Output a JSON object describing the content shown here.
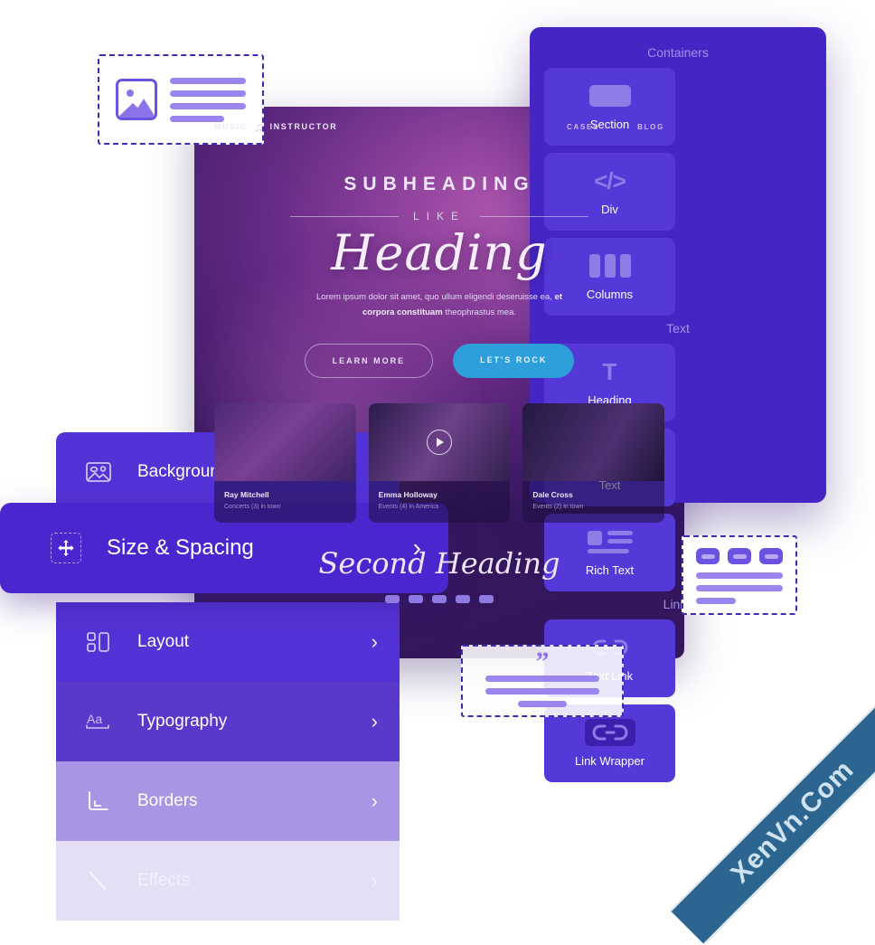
{
  "wireframes": {
    "image_block": {
      "name": "image-placeholder",
      "line_count": 4
    },
    "button_block": {
      "name": "button-placeholder",
      "button_count": 3,
      "line_count": 3
    },
    "quote_block": {
      "name": "quote-placeholder",
      "quote_glyph": "”",
      "line_count": 3
    }
  },
  "site": {
    "logo": {
      "word1": "MUSIC",
      "note_icon": "♫",
      "word2": "INSTRUCTOR"
    },
    "nav": [
      "CASES",
      "BLOG"
    ],
    "hero": {
      "subheading": "SUBHEADING",
      "like": "LIKE",
      "heading": "Heading",
      "copy_line1": "Lorem ipsum dolor sit amet, quo ullum eligendi",
      "copy_line2_plain": "deseruisse ea, ",
      "copy_line2_bold": "et corpora constituam",
      "copy_line3": "theophrastus mea.",
      "btn_primary": "LET'S ROCK",
      "btn_secondary": "LEARN MORE"
    },
    "cards": [
      {
        "title": "Ray Mitchell",
        "subtitle": "Concerts (3) in town"
      },
      {
        "title": "Emma Holloway",
        "subtitle": "Events (4) in America"
      },
      {
        "title": "Dale Cross",
        "subtitle": "Events (2) in town"
      }
    ],
    "second_heading": "Second Heading"
  },
  "panel": {
    "groups": [
      {
        "title": "Containers",
        "items": [
          {
            "label": "Section",
            "icon": "section-icon"
          },
          {
            "label": "Div",
            "icon": "code-icon",
            "glyph": "</>"
          },
          {
            "label": "Columns",
            "icon": "columns-icon"
          }
        ]
      },
      {
        "title": "Text",
        "items": [
          {
            "label": "Heading",
            "icon": "heading-t-icon",
            "glyph": "T"
          },
          {
            "label": "Text",
            "icon": "text-lines-icon"
          },
          {
            "label": "Rich Text",
            "icon": "rich-text-icon"
          }
        ]
      },
      {
        "title": "Links",
        "items": [
          {
            "label": "Text Link",
            "icon": "link-icon"
          },
          {
            "label": "Link Wrapper",
            "icon": "link-wrapper-icon"
          }
        ]
      }
    ]
  },
  "menu": {
    "chevron": "›",
    "items": [
      {
        "label": "Background",
        "icon": "image-icon",
        "state": "normal"
      },
      {
        "label": "Size & Spacing",
        "icon": "move-arrows-icon",
        "state": "active"
      },
      {
        "label": "Layout",
        "icon": "layout-icon",
        "state": "normal"
      },
      {
        "label": "Typography",
        "icon": "typography-icon",
        "state": "normal"
      },
      {
        "label": "Borders",
        "icon": "borders-icon",
        "state": "faded"
      },
      {
        "label": "Effects",
        "icon": "effects-icon",
        "state": "faded-more"
      }
    ]
  },
  "watermark": {
    "text": "XenVn.Com"
  },
  "colors": {
    "panel_bg": "#4526C4",
    "tile_bg": "#5438D8",
    "menu_bg": "#5433D6",
    "menu_active": "#4A26CF",
    "accent_blue": "#2F9FDB",
    "wire_purple": "#6C52E0",
    "ribbon": "#2B6590"
  }
}
